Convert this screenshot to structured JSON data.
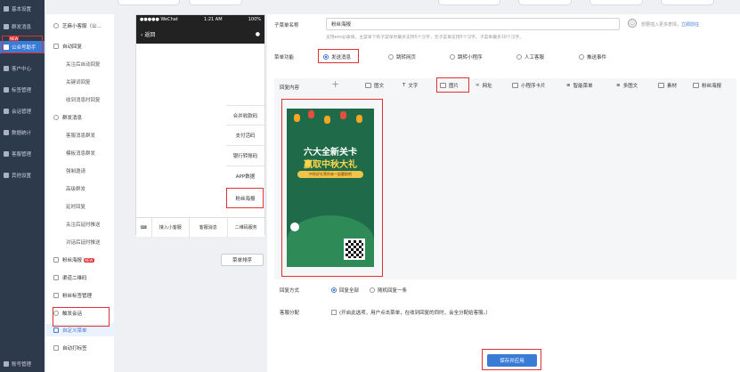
{
  "nav1": {
    "items": [
      "基本设置",
      "群发消息",
      "公众号助手",
      "客户中心",
      "标签管理",
      "会话管理",
      "数据统计",
      "客服管理",
      "其他设置",
      "账号管理"
    ],
    "new": "NEW"
  },
  "account": {
    "name": "芝麻小客服（公..."
  },
  "nav2": {
    "items": [
      "自动回复",
      "关注后自动回复",
      "关键词回复",
      "收到消息时回复",
      "群发消息",
      "客服消息群发",
      "模板消息群发",
      "强制邀请",
      "高级群发",
      "延时回复",
      "关注后延时推送",
      "对话后延时推送",
      "粉丝海报",
      "渠道二维码",
      "粉丝标签管理",
      "触发会话",
      "自定义菜单",
      "自动打标签"
    ],
    "new": "NEW"
  },
  "phone": {
    "carrier": "●●●●● WeChat",
    "time": "1:21 AM",
    "battery": "100%",
    "back": "返回",
    "user_icon": "person-icon"
  },
  "phone_menu": {
    "items": [
      "合并收款码",
      "支付活码",
      "银行转账码",
      "APP数据",
      "粉丝海报"
    ],
    "bottom": [
      "接入小客服",
      "客服消息",
      "二维码服务"
    ]
  },
  "sort_button": "菜单排序",
  "form": {
    "name_label": "子菜单名称",
    "name_value": "粉丝海报",
    "name_hint": "支持emoji表情，主菜单下有子菜单时最多支持5个汉字，无子菜单支持5个汉字。子菜单最多10个汉字。",
    "emoji_hint": "想要插入更多表情，",
    "emoji_link": "立即前往",
    "func_label": "菜单功能",
    "funcs": [
      "发送消息",
      "跳转网页",
      "跳转小程序",
      "人工客服",
      "推送事件"
    ],
    "content_label": "回复内容",
    "content_types": [
      "图文",
      "文字",
      "图片",
      "网址",
      "小程序卡片",
      "智能菜单",
      "多图文",
      "素材",
      "粉丝海报"
    ],
    "reply_label": "回复方式",
    "reply_opts": [
      "回复全部",
      "随机回复一条"
    ],
    "assign_label": "客服分配",
    "assign_text": "(开启此选项，用户点击菜单，在收到回复的同时，会全分配给客服。）",
    "save": "保存并应用"
  },
  "poster": {
    "line1": "六大全新关卡",
    "line2": "赢取中秋大礼",
    "sub": "中秋好礼等你来一起赢取吧"
  }
}
